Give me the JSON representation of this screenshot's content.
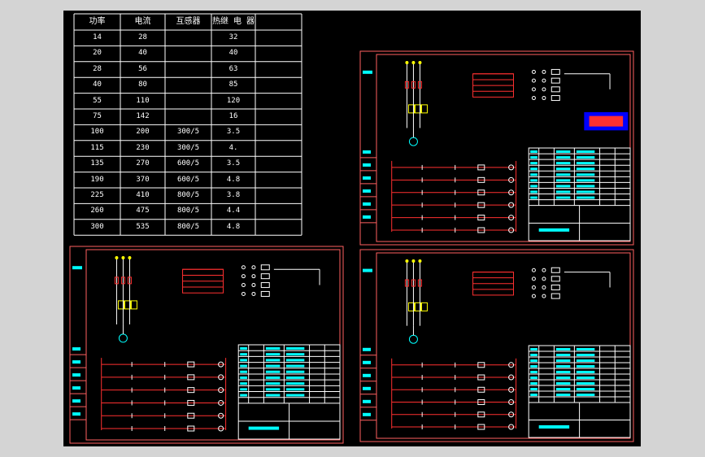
{
  "table": {
    "headers": [
      "功率",
      "电流",
      "互感器",
      "热继 电 器"
    ],
    "rows": [
      [
        "14",
        "28",
        "",
        "32"
      ],
      [
        "20",
        "40",
        "",
        "40"
      ],
      [
        "28",
        "56",
        "",
        "63"
      ],
      [
        "40",
        "80",
        "",
        "85"
      ],
      [
        "55",
        "110",
        "",
        "120"
      ],
      [
        "75",
        "142",
        "",
        "16"
      ],
      [
        "100",
        "200",
        "300/5",
        "3.5"
      ],
      [
        "115",
        "230",
        "300/5",
        "4."
      ],
      [
        "135",
        "270",
        "600/5",
        "3.5"
      ],
      [
        "190",
        "370",
        "600/5",
        "4.8"
      ],
      [
        "225",
        "410",
        "800/5",
        "3.8"
      ],
      [
        "260",
        "475",
        "800/5",
        "4.4"
      ],
      [
        "300",
        "535",
        "800/5",
        "4.8"
      ]
    ]
  },
  "colors": {
    "background": "#d4d4d4",
    "canvas": "#000000",
    "grid": "#ffffff",
    "frame": "#ff6060",
    "wire": "#ff3030",
    "component": "#ffffff",
    "label": "#00ffff",
    "terminal": "#ffff00",
    "accent": "#0000ff"
  }
}
